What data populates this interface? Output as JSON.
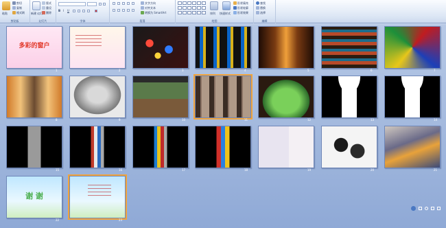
{
  "ribbon": {
    "clipboard": {
      "paste": "粘贴",
      "cut": "剪切",
      "copy": "复制",
      "format_painter": "格式刷",
      "label": "剪贴板"
    },
    "slides": {
      "new_slide": "新建\n幻灯片",
      "layout": "版式",
      "reset": "重设",
      "delete": "删除",
      "label": "幻灯片"
    },
    "font": {
      "label": "字体"
    },
    "paragraph": {
      "label": "段落",
      "text_direction": "文字方向",
      "align_text": "对齐文本",
      "smartart": "转换为 SmartArt"
    },
    "drawing": {
      "label": "绘图",
      "arrange": "排列",
      "quick_styles": "快速样式"
    },
    "editing": {
      "find": "查找",
      "replace": "替换",
      "select": "选择",
      "label": "编辑"
    },
    "shape_fill": "形状填充",
    "shape_outline": "形状轮廓",
    "shape_effects": "形状效果"
  },
  "slides": [
    {
      "num": "1",
      "title": "多彩的窗户"
    },
    {
      "num": "2"
    },
    {
      "num": "3"
    },
    {
      "num": "4"
    },
    {
      "num": "5"
    },
    {
      "num": "6"
    },
    {
      "num": "7"
    },
    {
      "num": "8"
    },
    {
      "num": "9"
    },
    {
      "num": "10"
    },
    {
      "num": "11"
    },
    {
      "num": "12"
    },
    {
      "num": "13"
    },
    {
      "num": "14"
    },
    {
      "num": "15"
    },
    {
      "num": "16"
    },
    {
      "num": "17"
    },
    {
      "num": "18"
    },
    {
      "num": "19"
    },
    {
      "num": "20"
    },
    {
      "num": "21"
    },
    {
      "num": "22",
      "title": "谢  谢"
    },
    {
      "num": "23"
    }
  ],
  "colors": {
    "accent_selection": "#f2a43a",
    "ribbon_text": "#2b3f66",
    "workspace": "#8fa9d6"
  }
}
